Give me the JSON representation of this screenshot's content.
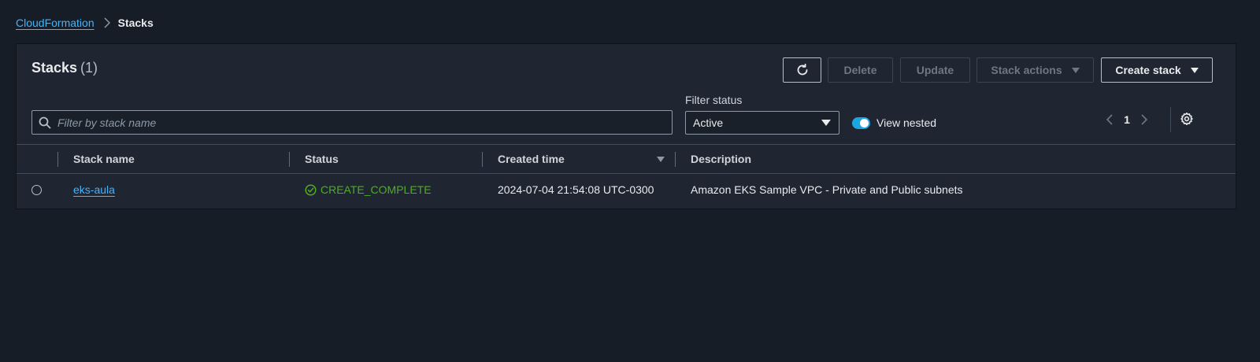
{
  "breadcrumb": {
    "parent": "CloudFormation",
    "current": "Stacks"
  },
  "header": {
    "title": "Stacks",
    "count": "(1)"
  },
  "actions": {
    "delete": "Delete",
    "update": "Update",
    "stack_actions": "Stack actions",
    "create_stack": "Create stack"
  },
  "search": {
    "placeholder": "Filter by stack name",
    "value": ""
  },
  "filter": {
    "label": "Filter status",
    "selected": "Active"
  },
  "view_nested": {
    "label": "View nested",
    "enabled": true
  },
  "pagination": {
    "current_page": "1"
  },
  "table": {
    "columns": [
      "Stack name",
      "Status",
      "Created time",
      "Description"
    ],
    "sorted_column": "Created time",
    "sort_direction": "descending",
    "rows": [
      {
        "stack_name": "eks-aula",
        "status": "CREATE_COMPLETE",
        "created_time": "2024-07-04 21:54:08 UTC-0300",
        "description": "Amazon EKS Sample VPC - Private and Public subnets"
      }
    ]
  },
  "colors": {
    "page_bg": "#161d26",
    "panel_bg": "#1f2631",
    "link": "#42b4ff",
    "success": "#4caf1f",
    "toggle_on": "#1ca6e0"
  },
  "icons": {
    "breadcrumb_separator": "chevron-right-icon",
    "refresh": "refresh-icon",
    "search": "search-icon",
    "settings": "gear-icon",
    "status": "check-circle-icon"
  }
}
